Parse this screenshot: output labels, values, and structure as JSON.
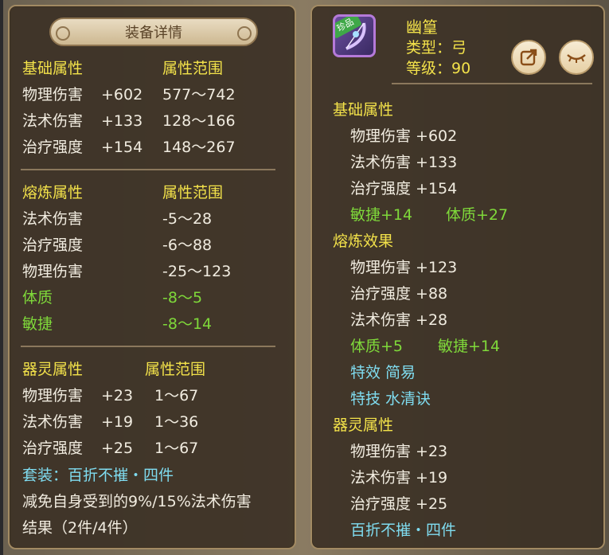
{
  "left": {
    "title": "装备详情",
    "base": {
      "header": "基础属性",
      "range_header": "属性范围",
      "rows": [
        {
          "name": "物理伤害",
          "value": "+602",
          "range": "577～742"
        },
        {
          "name": "法术伤害",
          "value": "+133",
          "range": "128～166"
        },
        {
          "name": "治疗强度",
          "value": "+154",
          "range": "148～267"
        }
      ]
    },
    "smelt": {
      "header": "熔炼属性",
      "range_header": "属性范围",
      "rows": [
        {
          "name": "法术伤害",
          "range": "-5～28"
        },
        {
          "name": "治疗强度",
          "range": "-6～88"
        },
        {
          "name": "物理伤害",
          "range": "-25～123"
        },
        {
          "name": "体质",
          "range": "-8～5"
        },
        {
          "name": "敏捷",
          "range": "-8～14"
        }
      ]
    },
    "spirit": {
      "header": "器灵属性",
      "range_header": "属性范围",
      "rows": [
        {
          "name": "物理伤害",
          "value": "+23",
          "range": "1～67"
        },
        {
          "name": "法术伤害",
          "value": "+19",
          "range": "1～36"
        },
        {
          "name": "治疗强度",
          "value": "+25",
          "range": "1～67"
        }
      ]
    },
    "set_label": "套装：百折不摧・四件",
    "set_desc": "减免自身受到的9%/15%法术伤害",
    "set_result": "结果（2件/4件）"
  },
  "right": {
    "item_badge": "珍品",
    "item_name": "幽篁",
    "item_type": "类型：弓",
    "item_level": "等级：90",
    "base": {
      "header": "基础属性",
      "rows": [
        "物理伤害  +602",
        "法术伤害  +133",
        "治疗强度  +154"
      ],
      "bonus_1": "敏捷+14",
      "bonus_2": "体质+27"
    },
    "smelt": {
      "header": "熔炼效果",
      "rows": [
        "物理伤害  +123",
        "治疗强度  +88",
        "法术伤害  +28"
      ],
      "bonus_1": "体质+5",
      "bonus_2": "敏捷+14"
    },
    "effect": "特效  简易",
    "skill": "特技  水清诀",
    "spirit": {
      "header": "器灵属性",
      "rows": [
        "物理伤害  +23",
        "法术伤害  +19",
        "治疗强度  +25"
      ]
    },
    "set_name": "百折不摧・四件"
  },
  "colors": {
    "yellow": "#f3e24a",
    "green": "#7fd93a",
    "cyan": "#7fdcf0",
    "white": "#f1ece0"
  },
  "icons": {
    "share": "share-icon",
    "hide": "eye-closed-icon"
  }
}
